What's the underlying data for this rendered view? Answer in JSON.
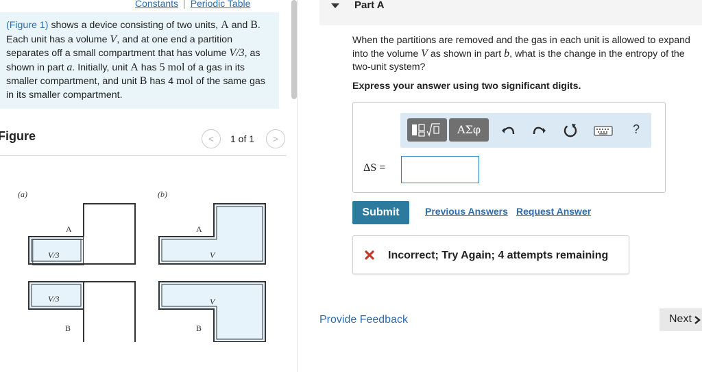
{
  "top_links": {
    "constants": "Constants",
    "separator": "|",
    "periodic_table": "Periodic Table"
  },
  "problem": {
    "figure_link": "(Figure 1)",
    "t1": " shows a device consisting of two units, ",
    "unit_a": "A",
    "t2": " and ",
    "unit_b": "B",
    "t3": ". Each unit has a volume ",
    "v": "V",
    "t4": ", and at one end a partition separates off a small compartment that has volume ",
    "v3": "V/3",
    "t5": ", as shown in part ",
    "part_a": "a",
    "t6": ". Initially, unit ",
    "unit_a2": "A",
    "t7": " has ",
    "amount_a": "5 mol",
    "t8": " of a gas in its smaller compartment, and unit ",
    "unit_b2": "B",
    "t9": " has 4 ",
    "mol_unit": "mol",
    "t10": " of the same gas in its smaller compartment."
  },
  "figure": {
    "heading": "Figure",
    "counter": "1 of 1",
    "prev_glyph": "<",
    "next_glyph": ">",
    "label_a": "(a)",
    "label_b": "(b)",
    "unit_a": "A",
    "unit_b": "B",
    "v3": "V/3",
    "v": "V"
  },
  "part": {
    "title": "Part A"
  },
  "question": {
    "q1": "When the partitions are removed and the gas in each unit is allowed to expand into the volume ",
    "v": "V",
    "q2": " as shown in part ",
    "part_b": "b",
    "q3": ", what is the change in the entropy of the two-unit system?",
    "instruction": "Express your answer using two significant digits."
  },
  "toolbar": {
    "greek": "ΑΣφ",
    "help": "?",
    "icons": [
      "templates-icon",
      "undo-icon",
      "redo-icon",
      "reset-icon",
      "keyboard-icon",
      "help-icon"
    ]
  },
  "answer": {
    "label": "ΔS =",
    "value": ""
  },
  "actions": {
    "submit": "Submit",
    "previous_answers": "Previous Answers",
    "request_answer": "Request Answer"
  },
  "feedback": {
    "message": "Incorrect; Try Again; 4 attempts remaining",
    "status": "incorrect"
  },
  "footer": {
    "provide_feedback": "Provide Feedback",
    "next": "Next"
  },
  "colors": {
    "accent_link": "#2c6cb0",
    "submit_bg": "#2c7b9e",
    "problem_bg": "#e9f5f8",
    "toolbar_bg": "#dbe9f5",
    "figure_fill": "#e7f3fa",
    "error_red": "#c0392b"
  }
}
